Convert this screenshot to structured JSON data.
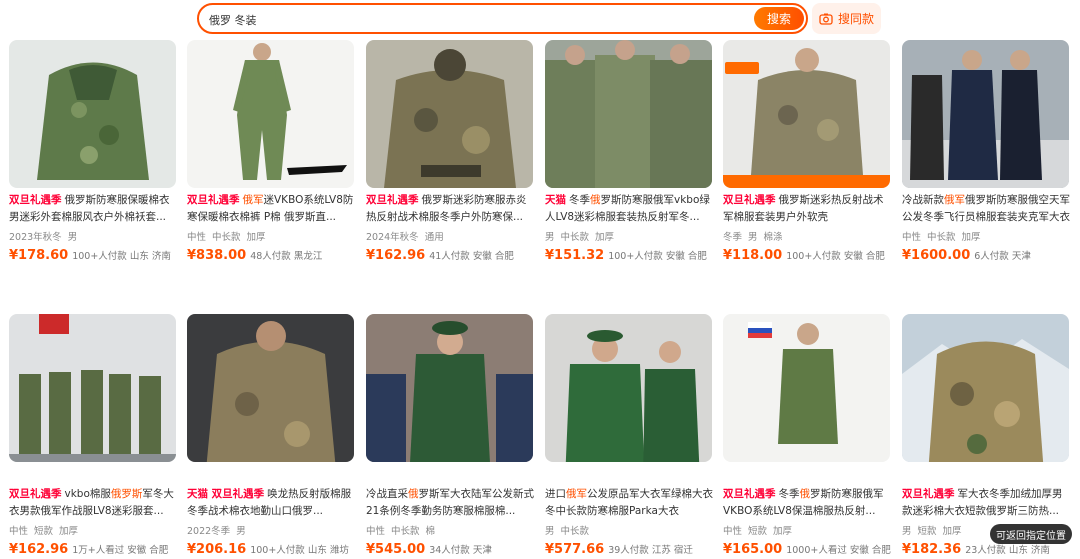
{
  "search": {
    "query": "俄罗 冬装",
    "button": "搜索",
    "photo_search": "搜同款"
  },
  "float_button": "可返回指定位置",
  "products": [
    {
      "tag": "双旦礼遇季",
      "title_pre": "俄罗斯防寒服保暖棉衣男迷彩外套棉服风衣户外棉袄套...",
      "hl": "",
      "title_post": "",
      "attrs": [
        "2023年秋冬",
        "男"
      ],
      "price": "¥178.60",
      "sales": "100+人付款",
      "location": "山东 济南"
    },
    {
      "tag": "双旦礼遇季",
      "title_pre": "",
      "hl": "俄军",
      "title_post": "迷VKBO系统LV8防寒保暖棉衣棉裤 P棉 俄罗斯直...",
      "attrs": [
        "中性",
        "中长款",
        "加厚"
      ],
      "price": "¥838.00",
      "sales": "48人付款",
      "location": "黑龙江"
    },
    {
      "tag": "双旦礼遇季",
      "title_pre": "俄罗斯迷彩防寒服赤炎热反射战术棉服冬季户外防寒保...",
      "hl": "",
      "title_post": "",
      "attrs": [
        "2024年秋冬",
        "通用"
      ],
      "price": "¥162.96",
      "sales": "41人付款",
      "location": "安徽 合肥"
    },
    {
      "tag": "天猫",
      "title_pre": "冬季",
      "hl": "俄",
      "title_post": "罗斯防寒服俄军vkbo绿人LV8迷彩棉服套装热反射军冬...",
      "attrs": [
        "男",
        "中长款",
        "加厚"
      ],
      "price": "¥151.32",
      "sales": "100+人付款",
      "location": "安徽 合肥"
    },
    {
      "tag": "双旦礼遇季",
      "title_pre": "俄罗斯迷彩热反射战术军棉服套装男户外软壳",
      "hl": "",
      "title_post": "",
      "attrs": [
        "冬季",
        "男",
        "棉涤"
      ],
      "price": "¥118.00",
      "sales": "100+人付款",
      "location": "安徽 合肥"
    },
    {
      "tag": "",
      "title_pre": "冷战新款",
      "hl": "俄军",
      "title_post": "俄罗斯防寒服俄空天军公发冬季飞行员棉服套装夹克军大衣",
      "attrs": [
        "中性",
        "中长款",
        "加厚"
      ],
      "price": "¥1600.00",
      "sales": "6人付款",
      "location": "天津"
    },
    {
      "tag": "双旦礼遇季",
      "title_pre": "vkbo棉服",
      "hl": "俄罗斯",
      "title_post": "军冬大衣男款俄军作战服LV8迷彩服套...",
      "attrs": [
        "中性",
        "短款",
        "加厚"
      ],
      "price": "¥162.96",
      "sales": "1万+人看过",
      "location": "安徽 合肥"
    },
    {
      "tag": "天猫 双旦礼遇季",
      "title_pre": "唤龙热反射版棉服冬季战术棉衣地勤山口俄罗...",
      "hl": "",
      "title_post": "",
      "attrs": [
        "2022冬季",
        "男"
      ],
      "price": "¥206.16",
      "sales": "100+人付款",
      "location": "山东 潍坊"
    },
    {
      "tag": "",
      "title_pre": "冷战直采",
      "hl": "俄",
      "title_post": "罗斯军大衣陆军公发新式21条例冬季勤务防寒服棉服棉...",
      "attrs": [
        "中性",
        "中长款",
        "棉"
      ],
      "price": "¥545.00",
      "sales": "34人付款",
      "location": "天津"
    },
    {
      "tag": "",
      "title_pre": "进口",
      "hl": "俄军",
      "title_post": "公发原品军大衣军绿棉大衣冬中长款防寒棉服Parka大衣",
      "attrs": [
        "男",
        "中长款"
      ],
      "price": "¥577.66",
      "sales": "39人付款",
      "location": "江苏 宿迁"
    },
    {
      "tag": "双旦礼遇季",
      "title_pre": "冬季",
      "hl": "俄",
      "title_post": "罗斯防寒服俄军VKBO系统LV8保温棉服热反射...",
      "attrs": [
        "中性",
        "短款",
        "加厚"
      ],
      "price": "¥165.00",
      "sales": "1000+人看过",
      "location": "安徽 合肥"
    },
    {
      "tag": "双旦礼遇季",
      "title_pre": "军大衣冬季加绒加厚男款迷彩棉大衣短款俄罗斯三防热...",
      "hl": "",
      "title_post": "",
      "attrs": [
        "男",
        "短款",
        "加厚"
      ],
      "price": "¥182.36",
      "sales": "23人付款",
      "location": "山东 济南"
    }
  ],
  "colors": {
    "accent": "#ff5000",
    "tag": "#ff0036"
  }
}
